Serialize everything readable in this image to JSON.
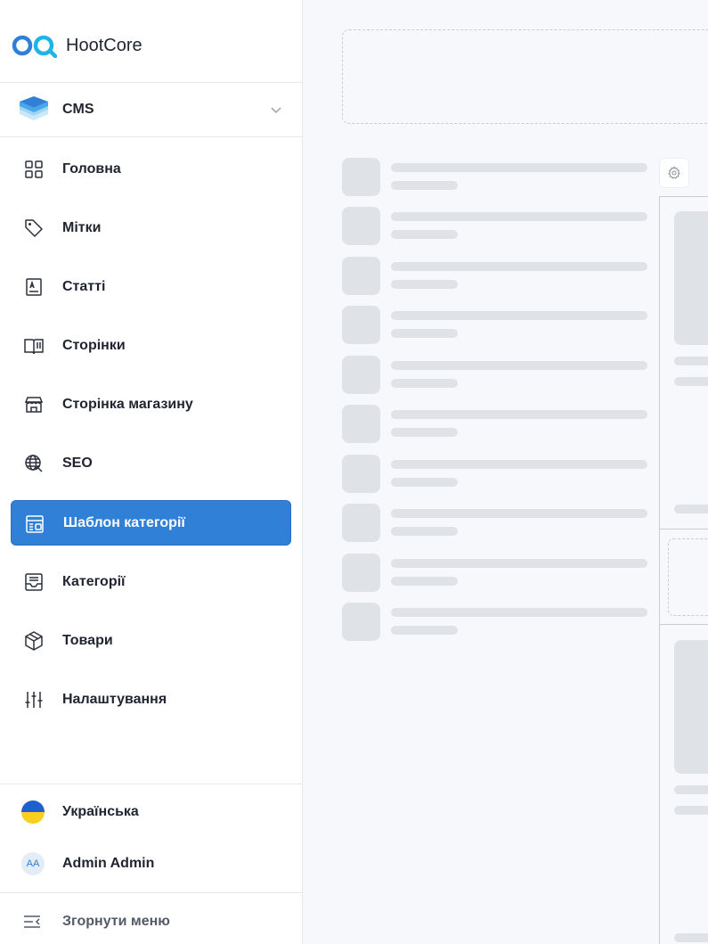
{
  "brand": {
    "name": "HootCore"
  },
  "workspace": {
    "label": "CMS"
  },
  "nav": {
    "items": [
      {
        "label": "Головна",
        "icon": "grid-icon"
      },
      {
        "label": "Мітки",
        "icon": "tag-icon"
      },
      {
        "label": "Статті",
        "icon": "article-icon"
      },
      {
        "label": "Сторінки",
        "icon": "book-icon"
      },
      {
        "label": "Сторінка магазину",
        "icon": "store-icon"
      },
      {
        "label": "SEO",
        "icon": "globe-icon"
      },
      {
        "label": "Шаблон категорії",
        "icon": "template-icon",
        "active": true
      },
      {
        "label": "Категорії",
        "icon": "inbox-icon"
      },
      {
        "label": "Товари",
        "icon": "box-icon"
      },
      {
        "label": "Налаштування",
        "icon": "sliders-icon"
      }
    ]
  },
  "language": {
    "label": "Українська",
    "icon": "ukraine-flag-icon"
  },
  "user": {
    "name": "Admin Admin",
    "initials": "AA"
  },
  "collapse": {
    "label": "Згорнути меню",
    "icon": "collapse-menu-icon"
  },
  "colors": {
    "accent": "#2f80d6",
    "skeleton": "#dfe2e6",
    "background": "#f7f8fb"
  }
}
